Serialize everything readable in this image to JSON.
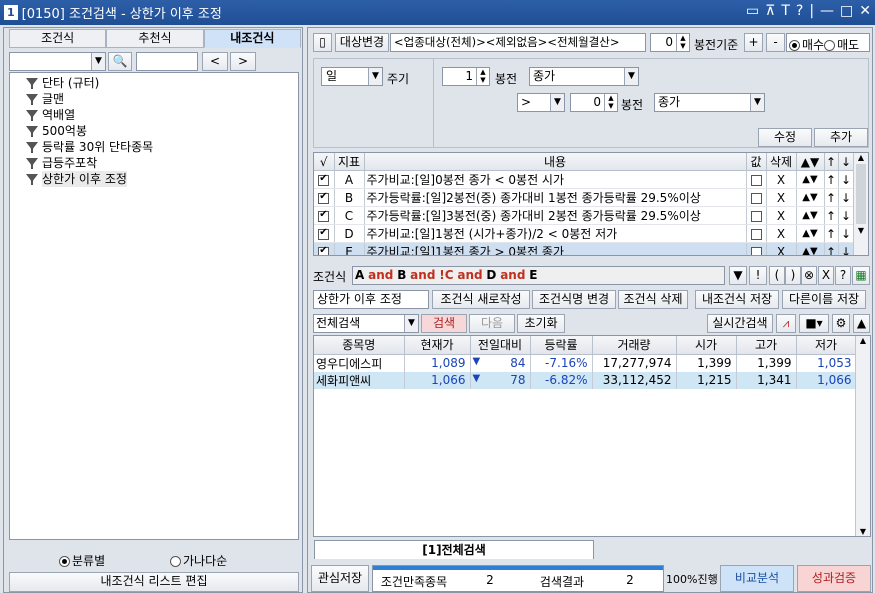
{
  "window": {
    "number": "1",
    "title": "[0150] 조건검색 - 상한가 이후 조정",
    "controls": [
      "▭",
      "⊼",
      "T",
      "?",
      "|",
      "—",
      "□",
      "✕"
    ]
  },
  "left": {
    "tabs": [
      "조건식",
      "추천식",
      "내조건식"
    ],
    "search": {
      "value": "",
      "placeholder": ""
    },
    "nav_prev": "<",
    "nav_next": ">",
    "tree": [
      "단타 (규터)",
      "글맨",
      "역배열",
      "500억봉",
      "등락률 30위 단타종목",
      "급등주포착",
      "상한가 이후 조정"
    ],
    "sort_options": [
      "분류별",
      "가나다순"
    ],
    "edit_button": "내조건식 리스트 편집"
  },
  "toolbar": {
    "target_change": "대상변경",
    "target_text": "<업종대상(전체)><제외없음><전체월결산>",
    "bong_value": "0",
    "bong_label": "봉전기준",
    "plus": "+",
    "minus": "-",
    "buy": "매수",
    "sell": "매도"
  },
  "cond_editor": {
    "period": "일",
    "period_label": "주기",
    "bong1": "1",
    "bong1_label": "봉전",
    "field1": "종가",
    "op": ">",
    "bong2": "0",
    "bong2_label": "봉전",
    "field2": "종가",
    "modify": "수정",
    "add": "추가"
  },
  "cond_table": {
    "headers": [
      "√",
      "지표",
      "내용",
      "값",
      "삭제",
      "▲▼",
      "↑",
      "↓"
    ],
    "rows": [
      {
        "id": "A",
        "content": "주가비교:[일]0봉전 종가 < 0봉전 시가",
        "del": "X"
      },
      {
        "id": "B",
        "content": "주가등락률:[일]2봉전(중) 종가대비 1봉전 종가등락률 29.5%이상",
        "del": "X"
      },
      {
        "id": "C",
        "content": "주가등락률:[일]3봉전(중) 종가대비 2봉전 종가등락률 29.5%이상",
        "del": "X"
      },
      {
        "id": "D",
        "content": "주가비교:[일]1봉전 (시가+종가)/2 < 0봉전 저가",
        "del": "X"
      },
      {
        "id": "E",
        "content": "주가비교:[일]1봉전 종가 > 0봉전 종가",
        "del": "X"
      }
    ]
  },
  "formula": {
    "label": "조건식",
    "tokens": [
      "A",
      "and",
      "B",
      "and",
      "!C",
      "and",
      "D",
      "and",
      "E"
    ],
    "buttons": [
      "▼",
      "!",
      "(",
      ")",
      "⊗",
      "X",
      "?",
      "▦"
    ]
  },
  "actions": {
    "name": "상한가 이후 조정",
    "new": "조건식 새로작성",
    "rename": "조건식명 변경",
    "delete": "조건식 삭제",
    "save": "내조건식 저장",
    "saveas": "다른이름 저장"
  },
  "search_bar": {
    "scope": "전체검색",
    "search": "검색",
    "next": "다음",
    "reset": "초기화",
    "realtime": "실시간검색"
  },
  "results": {
    "headers": [
      "종목명",
      "현재가",
      "전일대비",
      "등락률",
      "거래량",
      "시가",
      "고가",
      "저가"
    ],
    "rows": [
      {
        "name": "영우디에스피",
        "price": "1,089",
        "change": "84",
        "rate": "-7.16%",
        "volume": "17,277,974",
        "open": "1,399",
        "high": "1,399",
        "low": "1,053"
      },
      {
        "name": "세화피앤씨",
        "price": "1,066",
        "change": "78",
        "rate": "-6.82%",
        "volume": "33,112,452",
        "open": "1,215",
        "high": "1,341",
        "low": "1,066"
      }
    ],
    "tab": "[1]전체검색"
  },
  "status": {
    "watch_save": "관심저장",
    "match_label": "조건만족종목",
    "match_count": "2",
    "result_label": "검색결과",
    "result_count": "2",
    "progress": "100%진행",
    "progress_value": 1.0,
    "compare": "비교분석",
    "verify": "성과검증"
  }
}
